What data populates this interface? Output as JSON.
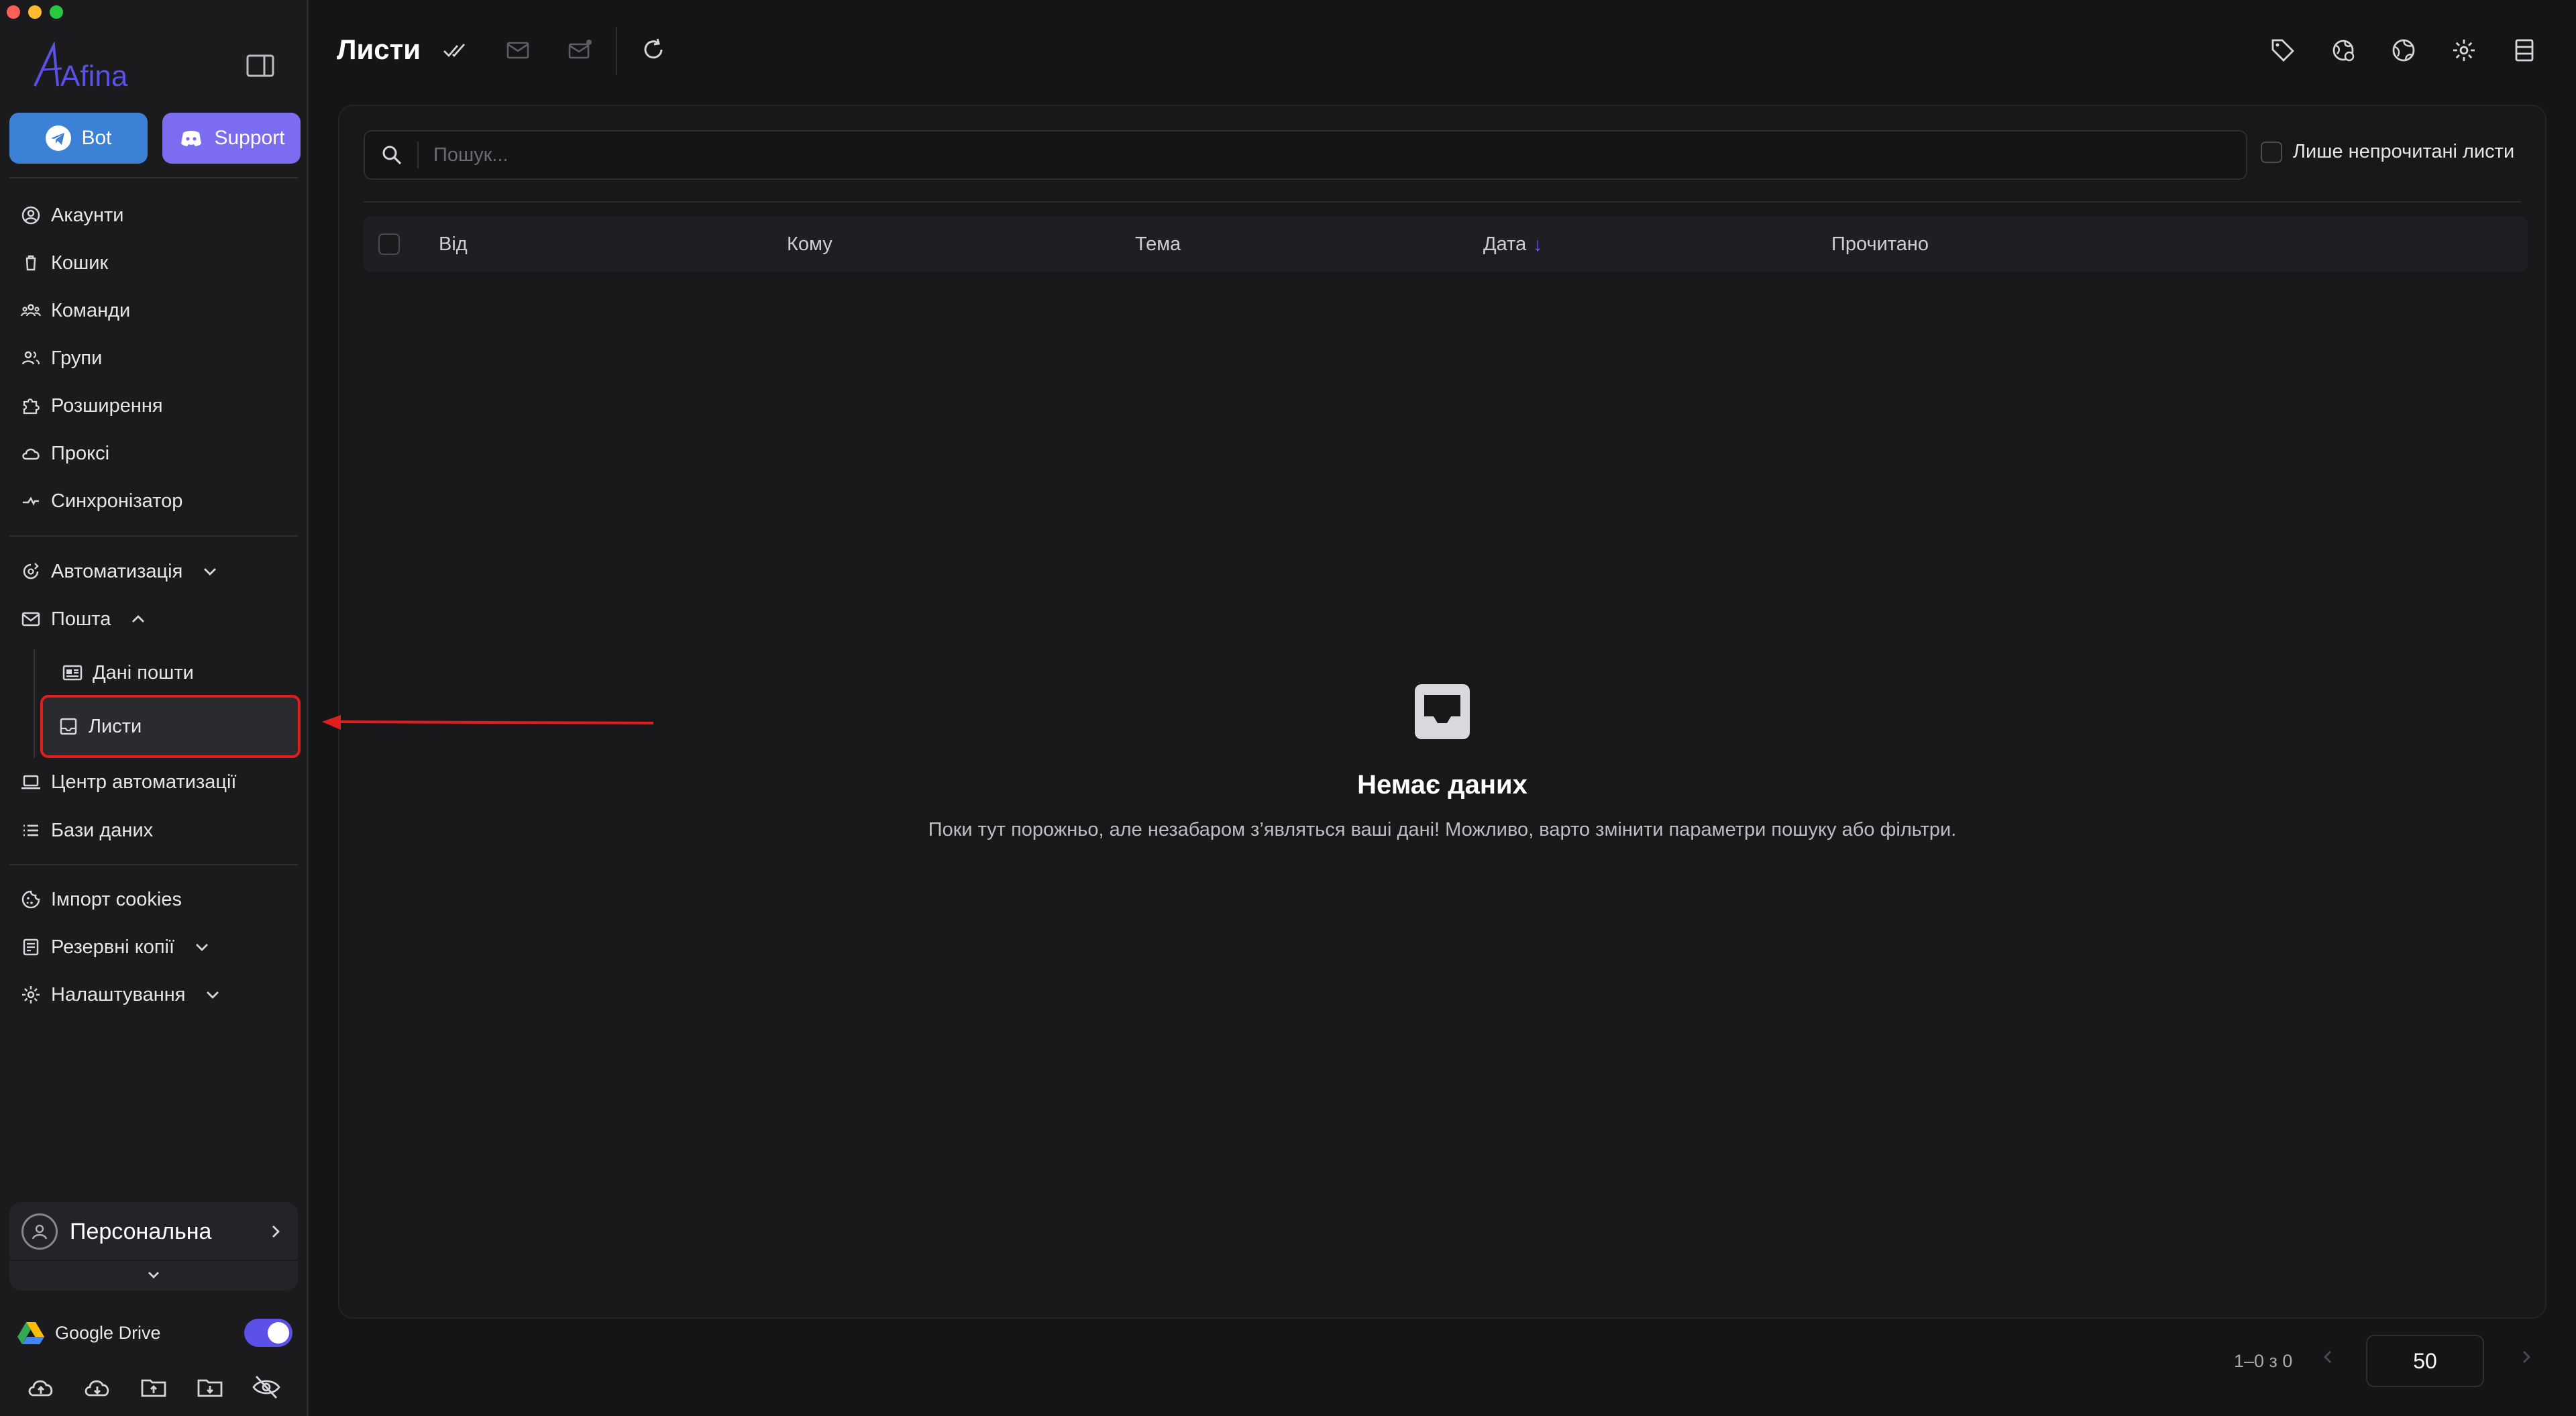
{
  "app": {
    "logo_text": "Afina"
  },
  "sidebar": {
    "buttons": {
      "bot": "Bot",
      "support": "Support"
    },
    "items": [
      {
        "label": "Акаунти",
        "icon": "user-circle-icon"
      },
      {
        "label": "Кошик",
        "icon": "trash-icon"
      },
      {
        "label": "Команди",
        "icon": "team-icon"
      },
      {
        "label": "Групи",
        "icon": "users-group-icon"
      },
      {
        "label": "Розширення",
        "icon": "puzzle-icon"
      },
      {
        "label": "Проксі",
        "icon": "cloud-icon"
      },
      {
        "label": "Синхронізатор",
        "icon": "sync-icon"
      }
    ],
    "automation": {
      "label": "Автоматизація"
    },
    "mail": {
      "label": "Пошта",
      "children": [
        {
          "label": "Дані пошти",
          "icon": "id-card-icon"
        },
        {
          "label": "Листи",
          "icon": "inbox-icon",
          "active": true
        }
      ]
    },
    "items2": [
      {
        "label": "Центр автоматизації",
        "icon": "laptop-icon"
      },
      {
        "label": "Бази даних",
        "icon": "list-icon"
      }
    ],
    "items3": [
      {
        "label": "Імпорт cookies",
        "icon": "cookie-icon"
      },
      {
        "label": "Резервні копії",
        "icon": "backup-icon"
      },
      {
        "label": "Налаштування",
        "icon": "gear-icon"
      }
    ],
    "profile": {
      "name": "Персональна"
    },
    "gdrive": {
      "label": "Google Drive",
      "enabled": true
    }
  },
  "header": {
    "title": "Листи"
  },
  "search": {
    "placeholder": "Пошук..."
  },
  "filter": {
    "unread_only": "Лише непрочитані листи"
  },
  "table": {
    "columns": [
      "Від",
      "Кому",
      "Тема",
      "Дата",
      "Прочитано"
    ],
    "sort_column": "Дата",
    "sort_direction": "desc",
    "rows": []
  },
  "empty_state": {
    "title": "Немає даних",
    "description": "Поки тут порожньо, але незабаром з’являться ваші дані! Можливо, варто змінити параметри пошуку або фільтри."
  },
  "pagination": {
    "range": "1–0 з 0",
    "page_size": "50"
  },
  "colors": {
    "accent": "#6b5cf0",
    "bot_button": "#3b82d6",
    "support_button": "#7c6cf0",
    "highlight_annotation": "#e01e1e"
  }
}
